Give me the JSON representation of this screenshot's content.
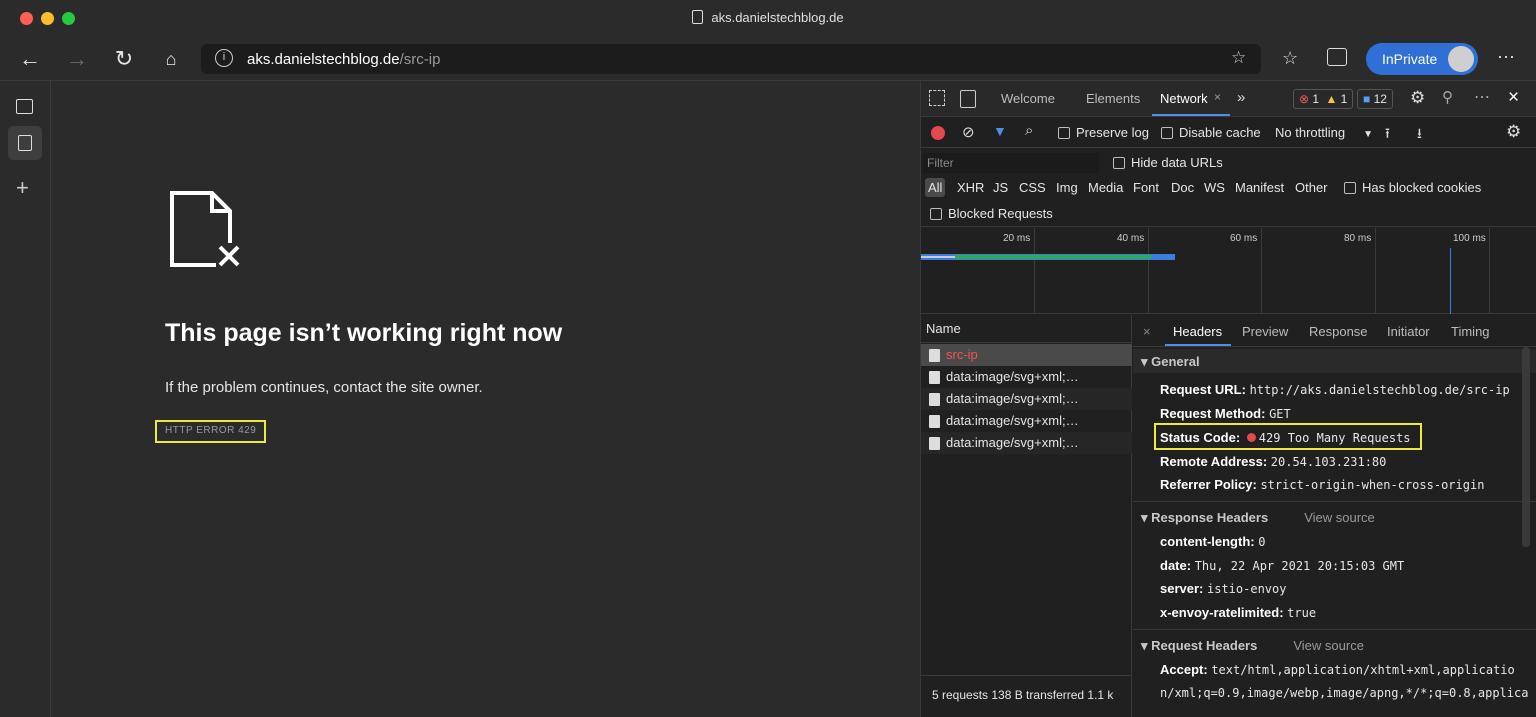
{
  "window": {
    "title": "aks.danielstechblog.de"
  },
  "address_bar": {
    "host": "aks.danielstechblog.de",
    "path": "/src-ip"
  },
  "profile": {
    "inprivate_label": "InPrivate"
  },
  "error_page": {
    "title": "This page isn’t working right now",
    "message": "If the problem continues, contact the site owner.",
    "code": "HTTP ERROR 429"
  },
  "devtools": {
    "tabs": [
      "Welcome",
      "Elements",
      "Network",
      "»"
    ],
    "counts": {
      "errors": "1",
      "warnings": "1",
      "messages": "12"
    },
    "toolbar": {
      "preserve_log": "Preserve log",
      "disable_cache": "Disable cache",
      "throttling": "No throttling"
    },
    "filter_placeholder": "Filter",
    "hide_data_urls": "Hide data URLs",
    "types": [
      "All",
      "XHR",
      "JS",
      "CSS",
      "Img",
      "Media",
      "Font",
      "Doc",
      "WS",
      "Manifest",
      "Other"
    ],
    "has_blocked_cookies": "Has blocked cookies",
    "blocked_requests": "Blocked Requests",
    "timeline_ticks": [
      "20 ms",
      "40 ms",
      "60 ms",
      "80 ms",
      "100 ms"
    ],
    "name_header": "Name",
    "requests": [
      "src-ip",
      "data:image/svg+xml;…",
      "data:image/svg+xml;…",
      "data:image/svg+xml;…",
      "data:image/svg+xml;…"
    ],
    "summary": "5 requests  138 B transferred  1.1 k",
    "detail_tabs": [
      "×",
      "Headers",
      "Preview",
      "Response",
      "Initiator",
      "Timing"
    ],
    "general": {
      "title": "▾ General",
      "request_url_k": "Request URL:",
      "request_url_v": "http://aks.danielstechblog.de/src-ip",
      "method_k": "Request Method:",
      "method_v": "GET",
      "status_k": "Status Code:",
      "status_v": "429 Too Many Requests",
      "remote_k": "Remote Address:",
      "remote_v": "20.54.103.231:80",
      "referrer_k": "Referrer Policy:",
      "referrer_v": "strict-origin-when-cross-origin"
    },
    "response_headers": {
      "title": "▾ Response Headers",
      "view_source": "View source",
      "items": [
        {
          "k": "content-length:",
          "v": "0"
        },
        {
          "k": "date:",
          "v": "Thu, 22 Apr 2021 20:15:03 GMT"
        },
        {
          "k": "server:",
          "v": "istio-envoy"
        },
        {
          "k": "x-envoy-ratelimited:",
          "v": "true"
        }
      ]
    },
    "request_headers": {
      "title": "▾ Request Headers",
      "view_source": "View source",
      "accept_k": "Accept:",
      "accept_v1": "text/html,application/xhtml+xml,applicatio",
      "accept_v2": "n/xml;q=0.9,image/webp,image/apng,*/*;q=0.8,applica"
    }
  }
}
